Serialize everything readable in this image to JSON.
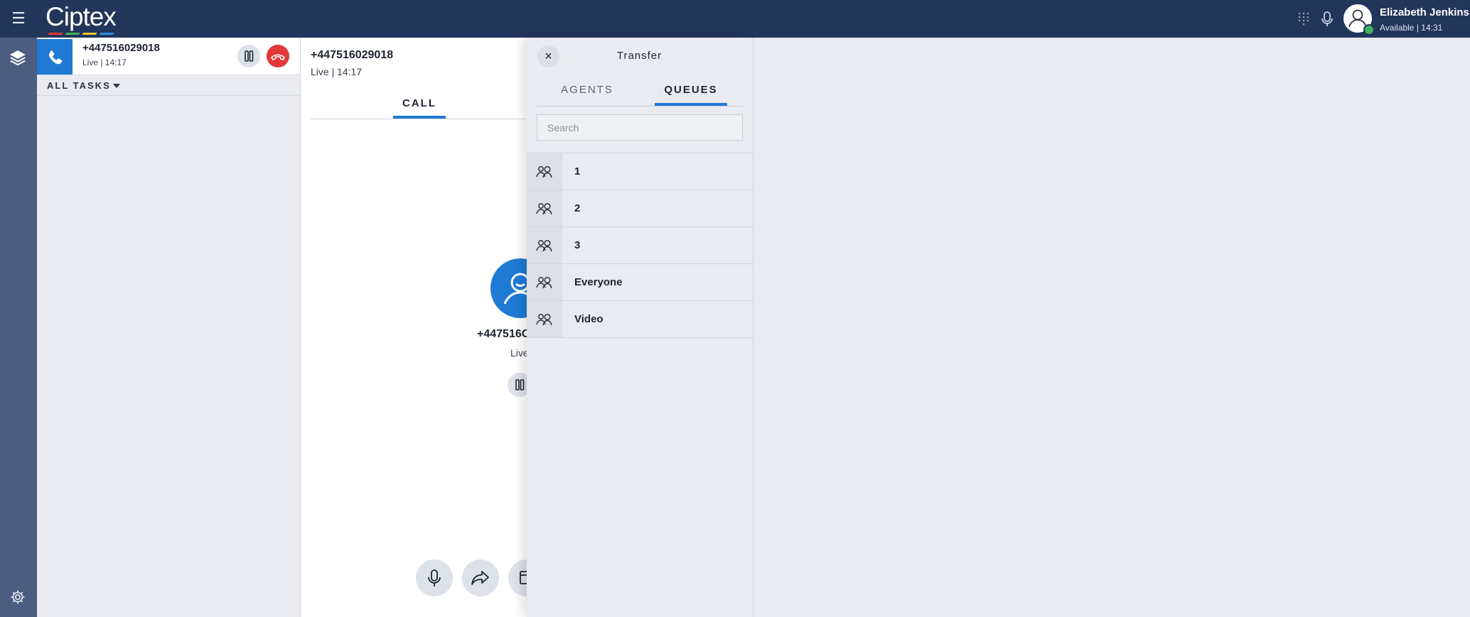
{
  "topbar": {
    "logo_text": "Ciptex",
    "logo_colors": [
      "#e23838",
      "#3fb25c",
      "#f2c230",
      "#2f8fe0"
    ],
    "icons": {
      "menu": "hamburger-icon",
      "dialpad": "grid-icon",
      "mic": "mic-icon",
      "avatar": "user-icon"
    },
    "user": {
      "name": "Elizabeth Jenkins",
      "status": "Available | 14:31"
    }
  },
  "leftnav": {
    "icons": [
      "layers-icon",
      "gear-icon"
    ]
  },
  "tasks": {
    "active": {
      "number": "+447516029018",
      "status": "Live | 14:17"
    },
    "filter_label": "ALL TASKS"
  },
  "call": {
    "number": "+447516029018",
    "status": "Live | 14:17",
    "tab_label": "CALL",
    "caller_number_visible": "+447516C",
    "caller_status_visible": "Live",
    "action_icons": [
      "mic-icon",
      "forward-icon",
      "calendar-icon"
    ]
  },
  "transfer": {
    "title": "Transfer",
    "close_glyph": "×",
    "tabs": [
      {
        "label": "AGENTS",
        "active": false
      },
      {
        "label": "QUEUES",
        "active": true
      }
    ],
    "search_placeholder": "Search",
    "search_value": "",
    "queues": [
      {
        "label": "1"
      },
      {
        "label": "2"
      },
      {
        "label": "3"
      },
      {
        "label": "Everyone"
      },
      {
        "label": "Video"
      }
    ]
  },
  "colors": {
    "topbar": "#22355a",
    "leftnav": "#4b5e82",
    "accent": "#1f7ad6",
    "hangup": "#e23838",
    "available": "#3fb25c"
  }
}
